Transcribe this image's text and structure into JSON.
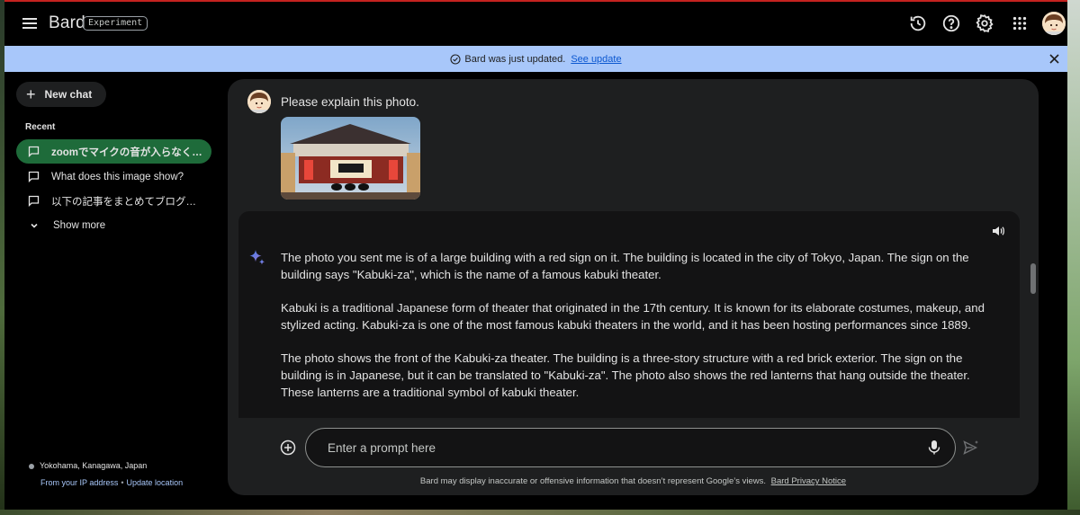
{
  "header": {
    "brand": "Bard",
    "badge": "Experiment",
    "icons": [
      "menu-icon",
      "history-icon",
      "help-icon",
      "gear-icon",
      "apps-icon"
    ]
  },
  "banner": {
    "text": "Bard was just updated.",
    "link": "See update"
  },
  "sidebar": {
    "new_chat": "New chat",
    "recent_label": "Recent",
    "items": [
      {
        "label": "zoomでマイクの音が入らなくな..."
      },
      {
        "label": "What does this image show?"
      },
      {
        "label": "以下の記事をまとめてブログの..."
      }
    ],
    "show_more": "Show more",
    "location": "Yokohama, Kanagawa, Japan",
    "location_source": "From your IP address",
    "update_location": "Update location"
  },
  "conversation": {
    "prompt": "Please explain this photo.",
    "response": [
      "The photo you sent me is of a large building with a red sign on it. The building is located in the city of Tokyo, Japan. The sign on the building says \"Kabuki-za\", which is the name of a famous kabuki theater.",
      "Kabuki is a traditional Japanese form of theater that originated in the 17th century. It is known for its elaborate costumes, makeup, and stylized acting. Kabuki-za is one of the most famous kabuki theaters in the world, and it has been hosting performances since 1889.",
      "The photo shows the front of the Kabuki-za theater. The building is a three-story structure with a red brick exterior. The sign on the building is in Japanese, but it can be translated to \"Kabuki-za\". The photo also shows the red lanterns that hang outside the theater. These lanterns are a traditional symbol of kabuki theater."
    ]
  },
  "input": {
    "placeholder": "Enter a prompt here"
  },
  "footer": {
    "disclaimer": "Bard may display inaccurate or offensive information that doesn’t represent Google’s views.",
    "privacy_link": "Bard Privacy Notice"
  },
  "colors": {
    "banner": "#a8c7fa",
    "active_chat": "#1e6b3a",
    "panel": "#1e1f20",
    "response_bg": "#131314"
  }
}
